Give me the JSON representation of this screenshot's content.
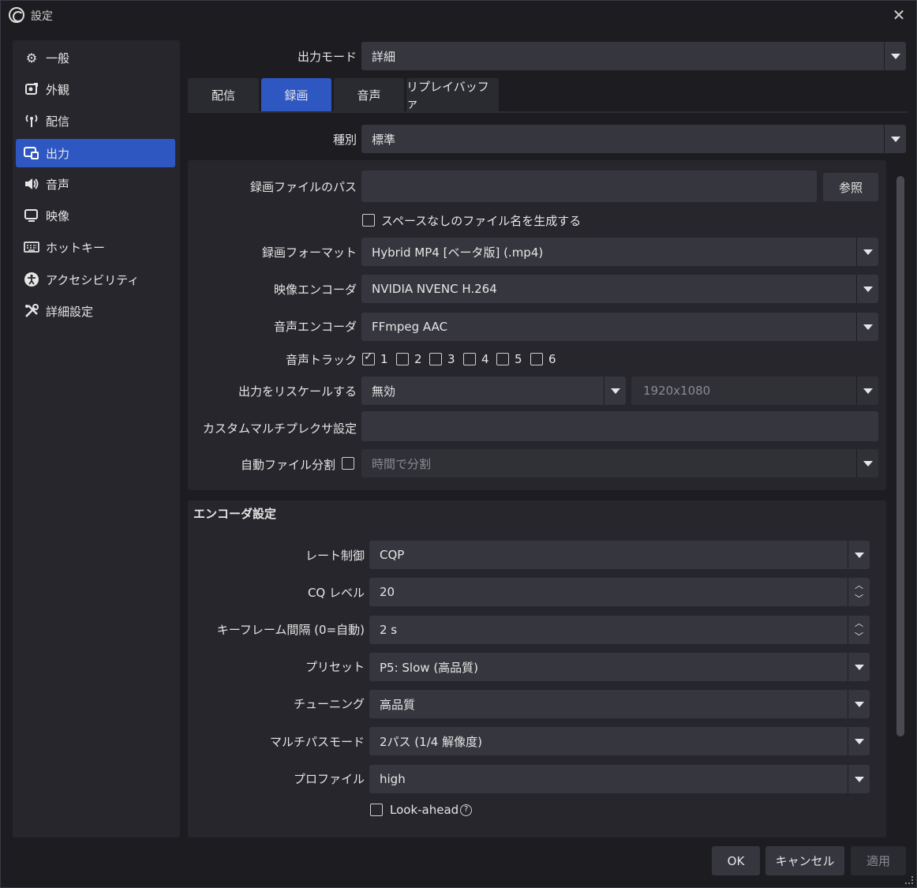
{
  "window": {
    "title": "設定",
    "close": "✕"
  },
  "sidebar": {
    "items": [
      {
        "label": "一般",
        "icon": "gear-icon"
      },
      {
        "label": "外観",
        "icon": "appearance-icon"
      },
      {
        "label": "配信",
        "icon": "antenna-icon"
      },
      {
        "label": "出力",
        "icon": "output-icon",
        "active": true
      },
      {
        "label": "音声",
        "icon": "speaker-icon"
      },
      {
        "label": "映像",
        "icon": "monitor-icon"
      },
      {
        "label": "ホットキー",
        "icon": "keyboard-icon"
      },
      {
        "label": "アクセシビリティ",
        "icon": "accessibility-icon"
      },
      {
        "label": "詳細設定",
        "icon": "wrench-icon"
      }
    ]
  },
  "output_mode": {
    "label": "出力モード",
    "value": "詳細"
  },
  "tabs": [
    {
      "label": "配信"
    },
    {
      "label": "録画",
      "active": true
    },
    {
      "label": "音声"
    },
    {
      "label": "リプレイバッファ"
    }
  ],
  "recording": {
    "type_label": "種別",
    "type_value": "標準",
    "path_label": "録画ファイルのパス",
    "path_value": "",
    "browse_button": "参照",
    "nospace_label": "スペースなしのファイル名を生成する",
    "format_label": "録画フォーマット",
    "format_value": "Hybrid MP4 [ベータ版] (.mp4)",
    "video_encoder_label": "映像エンコーダ",
    "video_encoder_value": "NVIDIA NVENC H.264",
    "audio_encoder_label": "音声エンコーダ",
    "audio_encoder_value": "FFmpeg AAC",
    "audio_track_label": "音声トラック",
    "tracks": [
      "1",
      "2",
      "3",
      "4",
      "5",
      "6"
    ],
    "rescale_label": "出力をリスケールする",
    "rescale_value": "無効",
    "rescale_resolution": "1920x1080",
    "muxer_label": "カスタムマルチプレクサ設定",
    "muxer_value": "",
    "split_label": "自動ファイル分割",
    "split_value": "時間で分割"
  },
  "encoder": {
    "section_title": "エンコーダ設定",
    "rate_control_label": "レート制御",
    "rate_control_value": "CQP",
    "cq_level_label": "CQ レベル",
    "cq_level_value": "20",
    "keyframe_label": "キーフレーム間隔 (0=自動)",
    "keyframe_value": "2 s",
    "preset_label": "プリセット",
    "preset_value": "P5: Slow (高品質)",
    "tuning_label": "チューニング",
    "tuning_value": "高品質",
    "multipass_label": "マルチパスモード",
    "multipass_value": "2パス (1/4 解像度)",
    "profile_label": "プロファイル",
    "profile_value": "high",
    "lookahead_label": "Look-ahead",
    "help_glyph": "?"
  },
  "footer": {
    "ok": "OK",
    "cancel": "キャンセル",
    "apply": "適用"
  }
}
